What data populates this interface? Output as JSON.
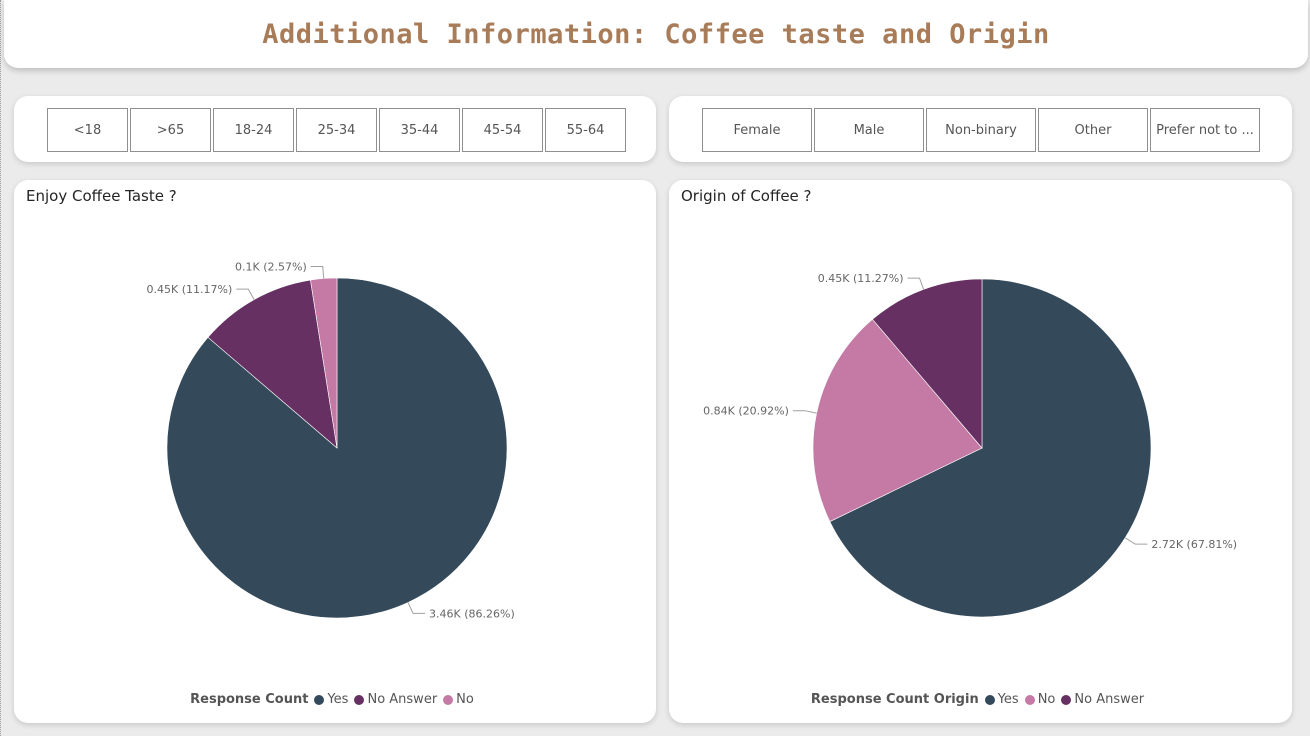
{
  "page": {
    "title": "Additional Information: Coffee taste and Origin"
  },
  "age_slicer": {
    "options": [
      "<18",
      ">65",
      "18-24",
      "25-34",
      "35-44",
      "45-54",
      "55-64"
    ]
  },
  "gender_slicer": {
    "options": [
      "Female",
      "Male",
      "Non-binary",
      "Other",
      "Prefer not to ..."
    ]
  },
  "colors": {
    "yes": "#34495a",
    "no": "#c47aa5",
    "no_answer": "#663162",
    "background": "#ebebeb",
    "title": "#a87c58"
  },
  "chart_data": [
    {
      "type": "pie",
      "title": "Enjoy Coffee Taste ?",
      "legend_title": "Response Count",
      "legend_position": "bottom-center",
      "categories": [
        "Yes",
        "No Answer",
        "No"
      ],
      "values": [
        3460,
        450,
        100
      ],
      "percentages": [
        86.26,
        11.17,
        2.57
      ],
      "data_labels": [
        "3.46K (86.26%)",
        "0.45K (11.17%)",
        "0.1K (2.57%)"
      ],
      "colors": [
        "#34495a",
        "#663162",
        "#c47aa5"
      ]
    },
    {
      "type": "pie",
      "title": "Origin of Coffee ?",
      "legend_title": "Response Count Origin",
      "legend_position": "bottom-center",
      "categories": [
        "Yes",
        "No",
        "No Answer"
      ],
      "values": [
        2720,
        840,
        450
      ],
      "percentages": [
        67.81,
        20.92,
        11.27
      ],
      "data_labels": [
        "2.72K (67.81%)",
        "0.84K (20.92%)",
        "0.45K (11.27%)"
      ],
      "colors": [
        "#34495a",
        "#c47aa5",
        "#663162"
      ]
    }
  ]
}
